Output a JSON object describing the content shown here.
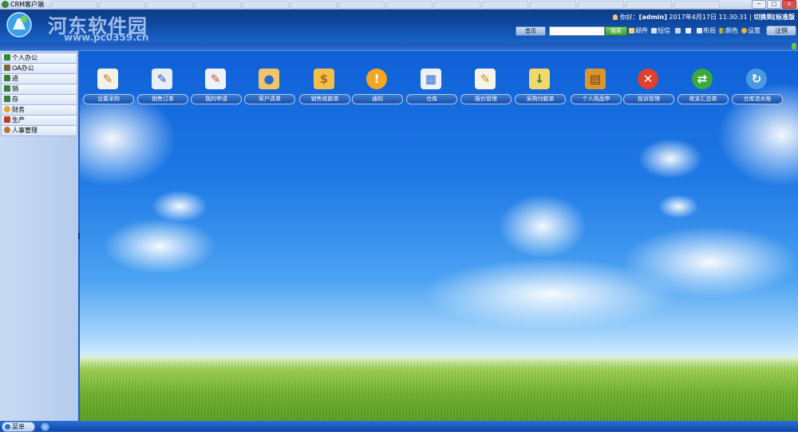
{
  "window": {
    "title": "CRM客户端",
    "controls": {
      "minimize": "−",
      "maximize": "□",
      "close": "×"
    }
  },
  "header": {
    "watermark_text": "河东软件园",
    "watermark_url": "www.pc0359.cn",
    "greeting": "你好：",
    "username": "[admin]",
    "date": "2017年4月17日",
    "time": "11:30:31",
    "divider": "|",
    "switch_label": "切换到[标准版"
  },
  "toolbar": {
    "home_label": "首页",
    "search_placeholder": "",
    "search_button": "搜索",
    "mail": "邮件",
    "sms": "短信",
    "layout": "布局",
    "color": "颜色",
    "settings": "设置",
    "logout": "注销"
  },
  "sidebar": {
    "items": [
      {
        "label": "个人办公",
        "icon": "pencil-icon",
        "color": "#2f8a3b"
      },
      {
        "label": "OA办公",
        "icon": "document-icon",
        "color": "#7a6a3a"
      },
      {
        "label": "进",
        "icon": "inbound-icon",
        "color": "#3b7d3a"
      },
      {
        "label": "销",
        "icon": "sales-icon",
        "color": "#3b7d3a"
      },
      {
        "label": "存",
        "icon": "stock-icon",
        "color": "#3b7d3a"
      },
      {
        "label": "财务",
        "icon": "finance-icon",
        "color": "#e0a72a"
      },
      {
        "label": "生产",
        "icon": "production-icon",
        "color": "#c0392b"
      },
      {
        "label": "人事管理",
        "icon": "person-icon",
        "color": "#b07a2a"
      }
    ]
  },
  "apps": [
    {
      "label": "设置采购",
      "icon": "document-pencil-icon",
      "bg": "#f4f1e6",
      "glyph": "✎",
      "fg": "#c07a1a"
    },
    {
      "label": "销售订单",
      "icon": "notepad-icon",
      "bg": "#e8eef8",
      "glyph": "✎",
      "fg": "#2c5aa8"
    },
    {
      "label": "我的申请",
      "icon": "form-icon",
      "bg": "#eef3fb",
      "glyph": "✎",
      "fg": "#d04a2a"
    },
    {
      "label": "客户清单",
      "icon": "customer-icon",
      "bg": "#f0c46a",
      "glyph": "●",
      "fg": "#2a6ac8"
    },
    {
      "label": "销售收款单",
      "icon": "coins-icon",
      "bg": "#f2c04a",
      "glyph": "$",
      "fg": "#a86a12"
    },
    {
      "label": "通知",
      "icon": "alert-icon",
      "bg": "#f3a623",
      "glyph": "!",
      "fg": "#ffffff"
    },
    {
      "label": "仓库",
      "icon": "warehouse-icon",
      "bg": "#eef2f8",
      "glyph": "▦",
      "fg": "#2f6fd0"
    },
    {
      "label": "报价管理",
      "icon": "quote-icon",
      "bg": "#f7f3e8",
      "glyph": "✎",
      "fg": "#c09022"
    },
    {
      "label": "采购付款单",
      "icon": "payment-icon",
      "bg": "#f0d86a",
      "glyph": "↓",
      "fg": "#2e8a2e"
    },
    {
      "label": "个人用品申",
      "icon": "cabinet-icon",
      "bg": "#d9962e",
      "glyph": "▤",
      "fg": "#6a3e0e"
    },
    {
      "label": "投诉管理",
      "icon": "cancel-icon",
      "bg": "#e04030",
      "glyph": "✕",
      "fg": "#ffffff"
    },
    {
      "label": "收支汇总单",
      "icon": "refresh-icon",
      "bg": "#3aaa3a",
      "glyph": "⇄",
      "fg": "#ffffff"
    },
    {
      "label": "仓库流水账",
      "icon": "cycle-icon",
      "bg": "#4a9ae0",
      "glyph": "↻",
      "fg": "#ffffff"
    }
  ],
  "taskbar": {
    "start_label": "菜单"
  }
}
